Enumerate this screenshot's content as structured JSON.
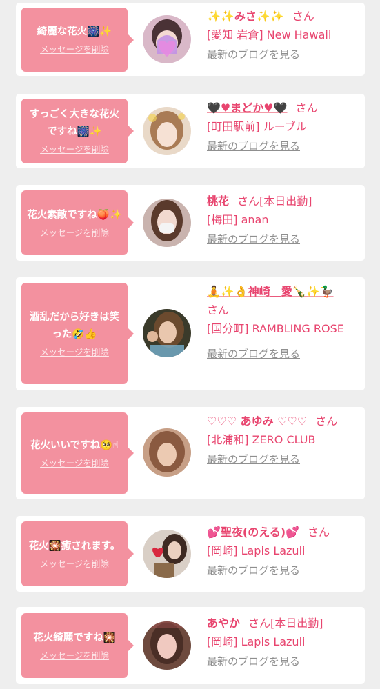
{
  "colors": {
    "accent": "#e8456f",
    "bubble": "#f3919f",
    "background": "#eeeeee"
  },
  "delete_label": "メッセージを削除",
  "blog_label": "最新のブログを見る",
  "san_label": "さん",
  "entries": [
    {
      "message": "綺麗な花火🎆✨",
      "name": "✨✨みさ✨✨",
      "san": "さん",
      "status": "",
      "shop": "[愛知 岩倉] New Hawaii"
    },
    {
      "message": "すっごく大きな花火ですね🎆✨",
      "name": "🖤♥まどか♥🖤",
      "san": "さん",
      "status": "",
      "shop": "[町田駅前] ルーブル"
    },
    {
      "message": "花火素敵ですね🍑✨",
      "name": "桃花",
      "san": "さん",
      "status": "[本日出勤]",
      "shop": "[梅田] anan"
    },
    {
      "message": "酒乱だから好きは笑った🤣👍",
      "name": "🧘✨👌神崎＿愛🍾✨🦆",
      "san": "さん",
      "status": "",
      "shop": "[国分町] RAMBLING ROSE"
    },
    {
      "message": "花火いいですね🥺☝",
      "name": "♡♡♡ あゆみ ♡♡♡",
      "san": "さん",
      "status": "",
      "shop": "[北浦和] ZERO CLUB"
    },
    {
      "message": "花火🎇癒されます。",
      "name": "💕聖夜(のえる)💕",
      "san": "さん",
      "status": "",
      "shop": "[岡崎] Lapis Lazuli"
    },
    {
      "message": "花火綺麗ですね🎇",
      "name": "あやか",
      "san": "さん",
      "status": "[本日出勤]",
      "shop": "[岡崎] Lapis Lazuli"
    }
  ]
}
